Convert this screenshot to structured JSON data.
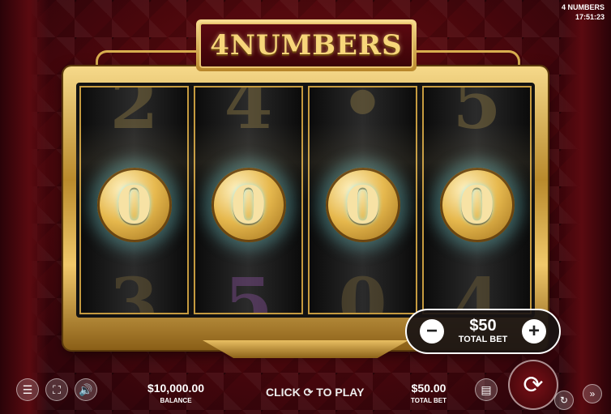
{
  "game": {
    "title": "4 NUMBERS",
    "clock": "17:51:23",
    "logo": "4NUMBERS"
  },
  "reels": [
    {
      "top": "2",
      "center": "0",
      "bottom": "3"
    },
    {
      "top": "4",
      "center": "0",
      "bottom": "5"
    },
    {
      "top": "•",
      "center": "0",
      "bottom": "0"
    },
    {
      "top": "5",
      "center": "0",
      "bottom": "4"
    }
  ],
  "bet_panel": {
    "amount": "$50",
    "label": "TOTAL BET",
    "minus_icon": "minus-icon",
    "plus_icon": "plus-icon"
  },
  "bottom_bar": {
    "balance_value": "$10,000.00",
    "balance_label": "BALANCE",
    "cta_prefix": "CLICK",
    "cta_suffix": "TO PLAY",
    "total_bet_value": "$50.00",
    "total_bet_label": "TOTAL BET",
    "icons": [
      "menu-icon",
      "fullscreen-icon",
      "sound-icon",
      "paytable-icon",
      "spin-icon",
      "autoplay-icon",
      "turbo-icon"
    ]
  }
}
